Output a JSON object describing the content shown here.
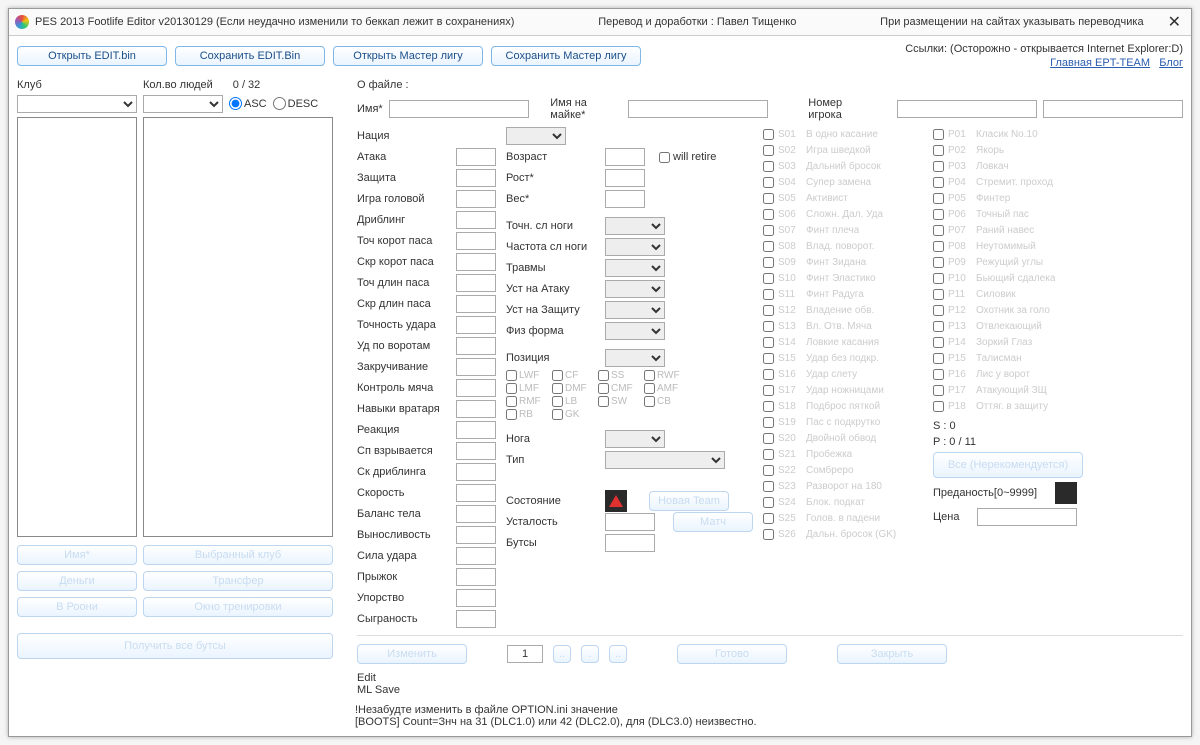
{
  "title": {
    "main": "PES 2013 Footlife Editor v20130129 (Если неудачно изменили то беккап лежит в сохранениях)",
    "credit": "Перевод и доработки : Павел Тищенко",
    "note": "При размещении на сайтах указывать переводчика"
  },
  "topbtn": {
    "open_edit": "Открыть EDIT.bin",
    "save_edit": "Сохранить EDIT.Bin",
    "open_ml": "Открыть Мастер лигу",
    "save_ml": "Сохранить Мастер лигу"
  },
  "links": {
    "warn": "Ссылки: (Осторожно - открывается Internet Explorer:D)",
    "l1": "Главная EPT-TEAM",
    "l2": "Блог"
  },
  "left": {
    "club": "Клуб",
    "count_lbl": "Кол.во людей",
    "count_val": "0 / 32",
    "asc": "ASC",
    "desc": "DESC",
    "b_name": "Имя*",
    "b_selclub": "Выбранный клуб",
    "b_money": "Деньги",
    "b_transfer": "Трансфер",
    "b_vrooms": "В Роони",
    "b_training": "Окно тренировки",
    "b_getboots": "Получить все бутсы"
  },
  "file_lbl": "О файле :",
  "name": {
    "name": "Имя*",
    "shirt": "Имя на майке*",
    "num": "Номер игрока"
  },
  "nation_lbl": "Нация",
  "stats": [
    "Атака",
    "Защита",
    "Игра головой",
    "Дриблинг",
    "Точ корот паса",
    "Скр корот паса",
    "Точ длин паса",
    "Скр длин паса",
    "Точность удара",
    "Уд по воротам",
    "Закручивание",
    "Контроль мяча",
    "Навыки вратаря",
    "Реакция",
    "Сп взрывается",
    "Ск дриблинга",
    "Скорость",
    "Баланс тела",
    "Выносливость",
    "Сила удара",
    "Прыжок",
    "Упорство",
    "Сыграность"
  ],
  "col2": {
    "age": "Возраст",
    "height": "Рост*",
    "weight": "Вес*",
    "retire": "will retire",
    "weak_acc": "Точн. сл ноги",
    "weak_freq": "Частота сл ноги",
    "injury": "Травмы",
    "atk_aw": "Уст на Атаку",
    "def_aw": "Уст на Защиту",
    "form": "Физ форма",
    "position": "Позиция",
    "foot": "Нога",
    "type": "Тип",
    "cond": "Состояние",
    "fatigue": "Усталость",
    "boots": "Бутсы",
    "b_newteam": "Новая Team",
    "b_match": "Матч"
  },
  "pos": [
    "LWF",
    "CF",
    "SS",
    "RWF",
    "LMF",
    "DMF",
    "CMF",
    "AMF",
    "RMF",
    "LB",
    "SW",
    "CB",
    "RB",
    "GK"
  ],
  "skills": [
    [
      "S01",
      "В одно касание"
    ],
    [
      "S02",
      "Игра шведкой"
    ],
    [
      "S03",
      "Дальний бросок"
    ],
    [
      "S04",
      "Супер замена"
    ],
    [
      "S05",
      "Активист"
    ],
    [
      "S06",
      "Сложн. Дал. Уда"
    ],
    [
      "S07",
      "Финт плеча"
    ],
    [
      "S08",
      "Влад. поворот."
    ],
    [
      "S09",
      "Финт Зидана"
    ],
    [
      "S10",
      "Финт Эластико"
    ],
    [
      "S11",
      "Финт Радуга"
    ],
    [
      "S12",
      "Владение обв."
    ],
    [
      "S13",
      "Вл. Отв. Мяча"
    ],
    [
      "S14",
      "Ловкие касания"
    ],
    [
      "S15",
      "Удар без подкр."
    ],
    [
      "S16",
      "Удар слету"
    ],
    [
      "S17",
      "Удар ножницами"
    ],
    [
      "S18",
      "Подброс пяткой"
    ],
    [
      "S19",
      "Пас с подкрутко"
    ],
    [
      "S20",
      "Двойной обвод"
    ],
    [
      "S21",
      "Пробежка"
    ],
    [
      "S22",
      "Сомбреро"
    ],
    [
      "S23",
      "Разворот на 180"
    ],
    [
      "S24",
      "Блок. подкат"
    ],
    [
      "S25",
      "Голов. в падени"
    ],
    [
      "S26",
      "Дальн. бросок (GK)"
    ]
  ],
  "play": [
    [
      "P01",
      "Класик No.10"
    ],
    [
      "P02",
      "Якорь"
    ],
    [
      "P03",
      "Ловкач"
    ],
    [
      "P04",
      "Стремит. проход"
    ],
    [
      "P05",
      "Финтер"
    ],
    [
      "P06",
      "Точный пас"
    ],
    [
      "P07",
      "Раний навес"
    ],
    [
      "P08",
      "Неутомимый"
    ],
    [
      "P09",
      "Режущий углы"
    ],
    [
      "P10",
      "Бьющий сдалека"
    ],
    [
      "P11",
      "Силовик"
    ],
    [
      "P12",
      "Охотник за голо"
    ],
    [
      "P13",
      "Отвлекающий"
    ],
    [
      "P14",
      "Зоркий Глаз"
    ],
    [
      "P15",
      "Талисман"
    ],
    [
      "P16",
      "Лис у ворот"
    ],
    [
      "P17",
      "Атакующий ЗЩ"
    ],
    [
      "P18",
      "Оттяг. в защиту"
    ]
  ],
  "sp": {
    "s": "S : 0",
    "p": "P : 0 / 11",
    "b_all": "Все (Нерекомендуется)",
    "loyal": "Преданость[0~9999]",
    "price": "Цена"
  },
  "bottom": {
    "b_change": "Изменить",
    "page": "1",
    "b_ready": "Готово",
    "b_close": "Закрыть"
  },
  "footer": {
    "edit": "Edit",
    "ml": "ML Save",
    "note1": "!Незабудте изменить в файле OPTION.ini значение",
    "note2": "[BOOTS] Count=Знч на 31 (DLC1.0) или 42 (DLC2.0), для (DLC3.0) неизвестно."
  }
}
